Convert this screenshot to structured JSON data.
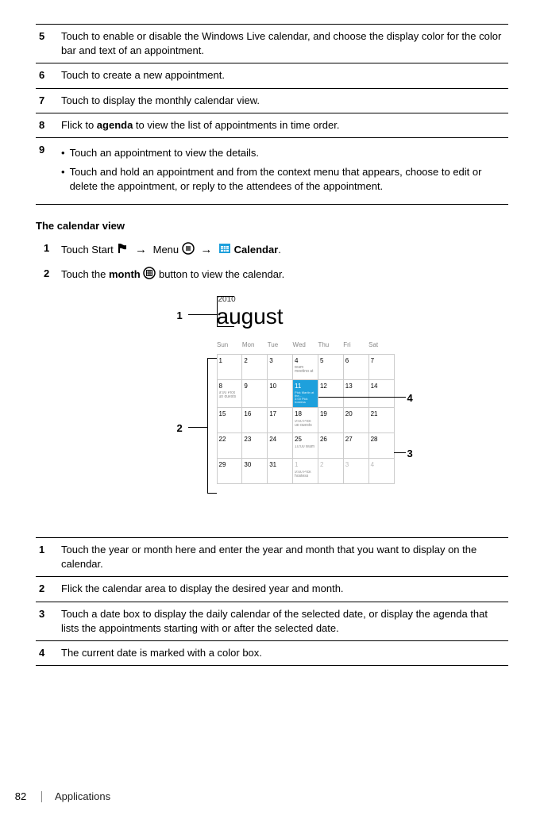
{
  "table1": {
    "rows": [
      {
        "num": "5",
        "text": "Touch to enable or disable the Windows Live calendar, and choose the display color for the color bar and text of an appointment."
      },
      {
        "num": "6",
        "text": "Touch to create a new appointment."
      },
      {
        "num": "7",
        "text": "Touch to display the monthly calendar view."
      },
      {
        "num": "8",
        "text_pre": "Flick to ",
        "bold": "agenda",
        "text_post": " to view the list of appointments in time order."
      },
      {
        "num": "9",
        "bullets": [
          "Touch an appointment to view the details.",
          "Touch and hold an appointment and from the context menu that appears, choose to edit or delete the appointment, or reply to the attendees of the appointment."
        ]
      }
    ]
  },
  "heading1": "The calendar view",
  "steps": [
    {
      "num": "1",
      "parts": {
        "pre": "Touch Start ",
        "mid1": " Menu ",
        "boldend": "Calendar",
        "period": "."
      }
    },
    {
      "num": "2",
      "parts": {
        "pre": "Touch the ",
        "bold1": "month",
        "post": " button to view the calendar."
      }
    }
  ],
  "figure": {
    "year": "2010",
    "month": "august",
    "weekdays": [
      "Sun",
      "Mon",
      "Tue",
      "Wed",
      "Thu",
      "Fri",
      "Sat"
    ],
    "days": [
      [
        "1",
        "2",
        "3",
        "4",
        "5",
        "6",
        "7"
      ],
      [
        "8",
        "9",
        "10",
        "11",
        "12",
        "13",
        "14"
      ],
      [
        "15",
        "16",
        "17",
        "18",
        "19",
        "20",
        "21"
      ],
      [
        "22",
        "23",
        "24",
        "25",
        "26",
        "27",
        "28"
      ],
      [
        "29",
        "30",
        "31",
        "1",
        "2",
        "3",
        "4"
      ]
    ],
    "today": "11",
    "callouts": {
      "c1": "1",
      "c2": "2",
      "c3": "3",
      "c4": "4"
    }
  },
  "table2": {
    "rows": [
      {
        "num": "1",
        "text": "Touch the year or month here and enter the year and month that you want to display on the calendar."
      },
      {
        "num": "2",
        "text": "Flick the calendar area to display the desired year and month."
      },
      {
        "num": "3",
        "text": "Touch a date box to display the daily calendar of the selected date, or display the agenda that lists the appointments starting with or after the selected date."
      },
      {
        "num": "4",
        "text": "The current date is marked with a color box."
      }
    ]
  },
  "footer": {
    "page": "82",
    "section": "Applications"
  }
}
